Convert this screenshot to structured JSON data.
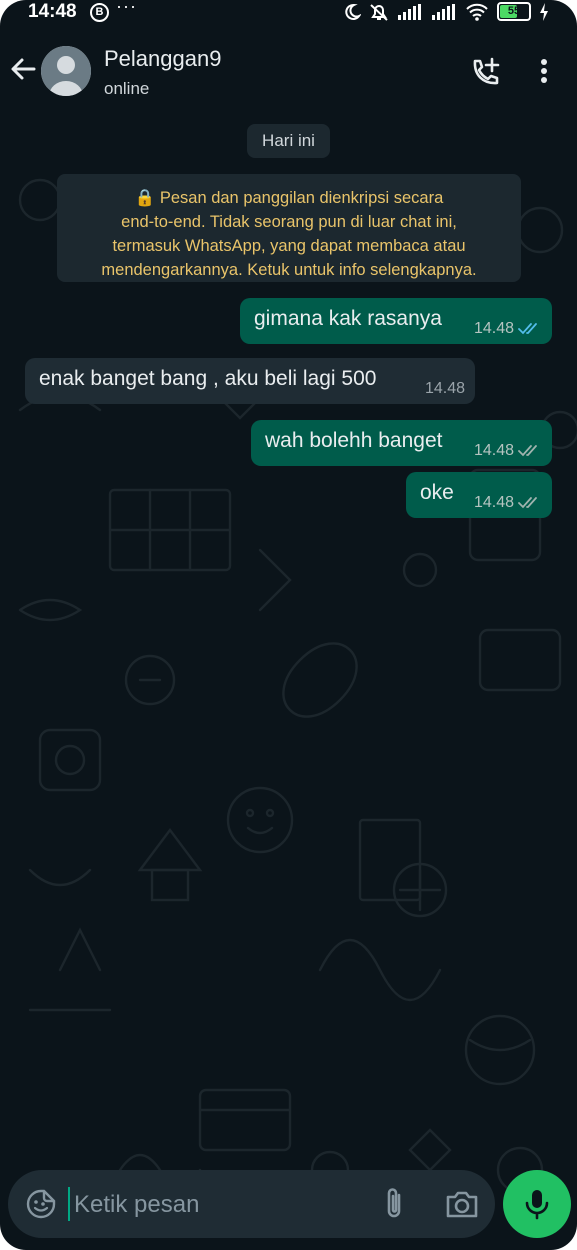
{
  "status_bar": {
    "time": "14:48",
    "b_badge": "B",
    "more": "···",
    "battery": "55"
  },
  "header": {
    "contact_name": "Pelanggan9",
    "contact_status": "online"
  },
  "chat": {
    "date_chip": "Hari ini",
    "encryption_notice": [
      "🔒 Pesan dan panggilan dienkripsi secara",
      "end-to-end. Tidak seorang pun di luar chat ini,",
      "termasuk WhatsApp, yang dapat membaca atau",
      "mendengarkannya. Ketuk untuk info selengkapnya."
    ],
    "messages": [
      {
        "direction": "out",
        "text": "gimana kak rasanya",
        "time": "14.48",
        "status": "read"
      },
      {
        "direction": "in",
        "text": "enak banget bang , aku beli lagi 500",
        "time": "14.48"
      },
      {
        "direction": "out",
        "text": "wah bolehh banget",
        "time": "14.48",
        "status": "delivered"
      },
      {
        "direction": "out",
        "text": "oke",
        "time": "14.48",
        "status": "delivered"
      }
    ]
  },
  "composer": {
    "placeholder": "Ketik pesan"
  },
  "colors": {
    "background": "#0b141a",
    "outgoing_bubble": "#005c4b",
    "incoming_bubble": "#1f2c34",
    "read_tick": "#53bdeb",
    "mic_button": "#21c063",
    "notice_text": "#e9c46a"
  },
  "icons": [
    "back-arrow-icon",
    "avatar-icon",
    "add-call-icon",
    "more-vertical-icon",
    "emoji-sticker-icon",
    "attach-icon",
    "camera-icon",
    "mic-icon",
    "lock-icon",
    "double-check-icon"
  ]
}
